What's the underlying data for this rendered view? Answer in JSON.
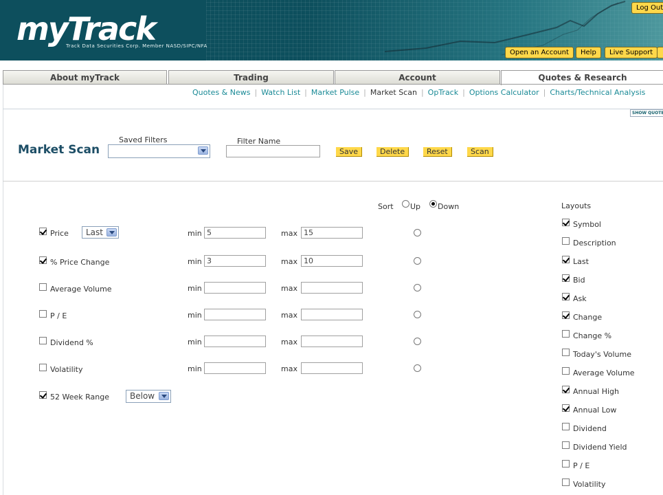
{
  "header": {
    "logo_text": "myTrack",
    "tagline": "Track Data Securities Corp. Member NASD/SIPC/NFA",
    "logout_label": "Log Out",
    "open_account_label": "Open an Account",
    "help_label": "Help",
    "live_support_label": "Live Support"
  },
  "tabs": [
    {
      "label": "About myTrack",
      "active": false
    },
    {
      "label": "Trading",
      "active": false
    },
    {
      "label": "Account",
      "active": false
    },
    {
      "label": "Quotes & Research",
      "active": true
    }
  ],
  "subnav": [
    {
      "label": "Quotes & News",
      "current": false
    },
    {
      "label": "Watch List",
      "current": false
    },
    {
      "label": "Market Pulse",
      "current": false
    },
    {
      "label": "Market Scan",
      "current": true
    },
    {
      "label": "OpTrack",
      "current": false
    },
    {
      "label": "Options Calculator",
      "current": false
    },
    {
      "label": "Charts/Technical Analysis",
      "current": false
    }
  ],
  "show_quote_label": "SHOW QUOTE",
  "page_title": "Market Scan",
  "filters": {
    "saved_filters_label": "Saved Filters",
    "saved_filters_value": "",
    "filter_name_label": "Filter Name",
    "filter_name_value": "",
    "buttons": {
      "save": "Save",
      "delete": "Delete",
      "reset": "Reset",
      "scan": "Scan"
    }
  },
  "sort": {
    "label": "Sort",
    "up": "Up",
    "down": "Down",
    "selected": "down"
  },
  "min_label": "min",
  "max_label": "max",
  "criteria": [
    {
      "label": "Price",
      "checked": true,
      "select": "Last",
      "min": "5",
      "max": "15"
    },
    {
      "label": "% Price Change",
      "checked": true,
      "min": "3",
      "max": "10"
    },
    {
      "label": "Average Volume",
      "checked": false,
      "min": "",
      "max": ""
    },
    {
      "label": "P / E",
      "checked": false,
      "min": "",
      "max": ""
    },
    {
      "label": "Dividend %",
      "checked": false,
      "min": "",
      "max": ""
    },
    {
      "label": "Volatility",
      "checked": false,
      "min": "",
      "max": ""
    }
  ],
  "week_range": {
    "label": "52 Week Range",
    "checked": true,
    "select": "Below"
  },
  "layouts": {
    "title": "Layouts",
    "items": [
      {
        "label": "Symbol",
        "checked": true
      },
      {
        "label": "Description",
        "checked": false
      },
      {
        "label": "Last",
        "checked": true
      },
      {
        "label": "Bid",
        "checked": true
      },
      {
        "label": "Ask",
        "checked": true
      },
      {
        "label": "Change",
        "checked": true
      },
      {
        "label": "Change %",
        "checked": false
      },
      {
        "label": "Today's Volume",
        "checked": false
      },
      {
        "label": "Average Volume",
        "checked": false
      },
      {
        "label": "Annual High",
        "checked": true
      },
      {
        "label": "Annual Low",
        "checked": true
      },
      {
        "label": "Dividend",
        "checked": false
      },
      {
        "label": "Dividend Yield",
        "checked": false
      },
      {
        "label": "P / E",
        "checked": false
      },
      {
        "label": "Volatility",
        "checked": false
      }
    ]
  }
}
